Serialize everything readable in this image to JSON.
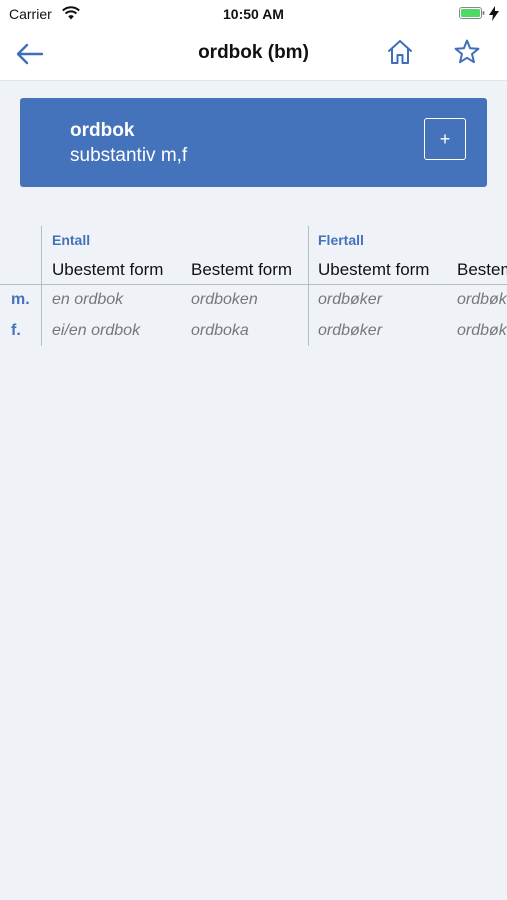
{
  "status": {
    "carrier": "Carrier",
    "time": "10:50 AM"
  },
  "nav": {
    "title": "ordbok (bm)"
  },
  "card": {
    "word": "ordbok",
    "pos": "substantiv m,f",
    "add_label": "+"
  },
  "table": {
    "groups": [
      "Entall",
      "Flertall"
    ],
    "columns": [
      "Ubestemt form",
      "Bestemt form",
      "Ubestemt form",
      "Bestemt form"
    ],
    "rows": [
      {
        "gender": "m.",
        "cells": [
          "en ordbok",
          "ordboken",
          "ordbøker",
          "ordbøkene"
        ]
      },
      {
        "gender": "f.",
        "cells": [
          "ei/en ordbok",
          "ordboka",
          "ordbøker",
          "ordbøkene"
        ]
      }
    ]
  },
  "colors": {
    "accent": "#4472bb",
    "background": "#eff3f8"
  }
}
